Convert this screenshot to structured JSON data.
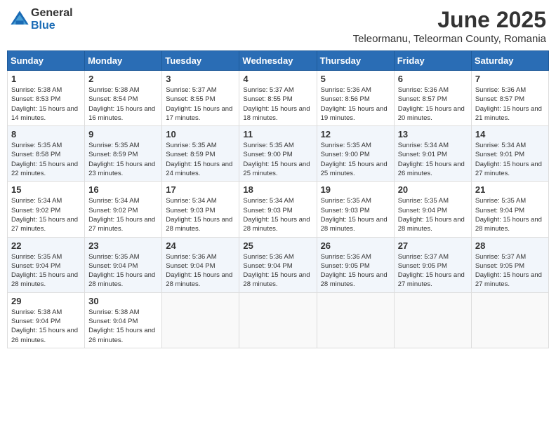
{
  "header": {
    "logo_general": "General",
    "logo_blue": "Blue",
    "month_title": "June 2025",
    "location": "Teleormanu, Teleorman County, Romania"
  },
  "weekdays": [
    "Sunday",
    "Monday",
    "Tuesday",
    "Wednesday",
    "Thursday",
    "Friday",
    "Saturday"
  ],
  "weeks": [
    [
      {
        "day": "1",
        "sunrise": "Sunrise: 5:38 AM",
        "sunset": "Sunset: 8:53 PM",
        "daylight": "Daylight: 15 hours and 14 minutes."
      },
      {
        "day": "2",
        "sunrise": "Sunrise: 5:38 AM",
        "sunset": "Sunset: 8:54 PM",
        "daylight": "Daylight: 15 hours and 16 minutes."
      },
      {
        "day": "3",
        "sunrise": "Sunrise: 5:37 AM",
        "sunset": "Sunset: 8:55 PM",
        "daylight": "Daylight: 15 hours and 17 minutes."
      },
      {
        "day": "4",
        "sunrise": "Sunrise: 5:37 AM",
        "sunset": "Sunset: 8:55 PM",
        "daylight": "Daylight: 15 hours and 18 minutes."
      },
      {
        "day": "5",
        "sunrise": "Sunrise: 5:36 AM",
        "sunset": "Sunset: 8:56 PM",
        "daylight": "Daylight: 15 hours and 19 minutes."
      },
      {
        "day": "6",
        "sunrise": "Sunrise: 5:36 AM",
        "sunset": "Sunset: 8:57 PM",
        "daylight": "Daylight: 15 hours and 20 minutes."
      },
      {
        "day": "7",
        "sunrise": "Sunrise: 5:36 AM",
        "sunset": "Sunset: 8:57 PM",
        "daylight": "Daylight: 15 hours and 21 minutes."
      }
    ],
    [
      {
        "day": "8",
        "sunrise": "Sunrise: 5:35 AM",
        "sunset": "Sunset: 8:58 PM",
        "daylight": "Daylight: 15 hours and 22 minutes."
      },
      {
        "day": "9",
        "sunrise": "Sunrise: 5:35 AM",
        "sunset": "Sunset: 8:59 PM",
        "daylight": "Daylight: 15 hours and 23 minutes."
      },
      {
        "day": "10",
        "sunrise": "Sunrise: 5:35 AM",
        "sunset": "Sunset: 8:59 PM",
        "daylight": "Daylight: 15 hours and 24 minutes."
      },
      {
        "day": "11",
        "sunrise": "Sunrise: 5:35 AM",
        "sunset": "Sunset: 9:00 PM",
        "daylight": "Daylight: 15 hours and 25 minutes."
      },
      {
        "day": "12",
        "sunrise": "Sunrise: 5:35 AM",
        "sunset": "Sunset: 9:00 PM",
        "daylight": "Daylight: 15 hours and 25 minutes."
      },
      {
        "day": "13",
        "sunrise": "Sunrise: 5:34 AM",
        "sunset": "Sunset: 9:01 PM",
        "daylight": "Daylight: 15 hours and 26 minutes."
      },
      {
        "day": "14",
        "sunrise": "Sunrise: 5:34 AM",
        "sunset": "Sunset: 9:01 PM",
        "daylight": "Daylight: 15 hours and 27 minutes."
      }
    ],
    [
      {
        "day": "15",
        "sunrise": "Sunrise: 5:34 AM",
        "sunset": "Sunset: 9:02 PM",
        "daylight": "Daylight: 15 hours and 27 minutes."
      },
      {
        "day": "16",
        "sunrise": "Sunrise: 5:34 AM",
        "sunset": "Sunset: 9:02 PM",
        "daylight": "Daylight: 15 hours and 27 minutes."
      },
      {
        "day": "17",
        "sunrise": "Sunrise: 5:34 AM",
        "sunset": "Sunset: 9:03 PM",
        "daylight": "Daylight: 15 hours and 28 minutes."
      },
      {
        "day": "18",
        "sunrise": "Sunrise: 5:34 AM",
        "sunset": "Sunset: 9:03 PM",
        "daylight": "Daylight: 15 hours and 28 minutes."
      },
      {
        "day": "19",
        "sunrise": "Sunrise: 5:35 AM",
        "sunset": "Sunset: 9:03 PM",
        "daylight": "Daylight: 15 hours and 28 minutes."
      },
      {
        "day": "20",
        "sunrise": "Sunrise: 5:35 AM",
        "sunset": "Sunset: 9:04 PM",
        "daylight": "Daylight: 15 hours and 28 minutes."
      },
      {
        "day": "21",
        "sunrise": "Sunrise: 5:35 AM",
        "sunset": "Sunset: 9:04 PM",
        "daylight": "Daylight: 15 hours and 28 minutes."
      }
    ],
    [
      {
        "day": "22",
        "sunrise": "Sunrise: 5:35 AM",
        "sunset": "Sunset: 9:04 PM",
        "daylight": "Daylight: 15 hours and 28 minutes."
      },
      {
        "day": "23",
        "sunrise": "Sunrise: 5:35 AM",
        "sunset": "Sunset: 9:04 PM",
        "daylight": "Daylight: 15 hours and 28 minutes."
      },
      {
        "day": "24",
        "sunrise": "Sunrise: 5:36 AM",
        "sunset": "Sunset: 9:04 PM",
        "daylight": "Daylight: 15 hours and 28 minutes."
      },
      {
        "day": "25",
        "sunrise": "Sunrise: 5:36 AM",
        "sunset": "Sunset: 9:04 PM",
        "daylight": "Daylight: 15 hours and 28 minutes."
      },
      {
        "day": "26",
        "sunrise": "Sunrise: 5:36 AM",
        "sunset": "Sunset: 9:05 PM",
        "daylight": "Daylight: 15 hours and 28 minutes."
      },
      {
        "day": "27",
        "sunrise": "Sunrise: 5:37 AM",
        "sunset": "Sunset: 9:05 PM",
        "daylight": "Daylight: 15 hours and 27 minutes."
      },
      {
        "day": "28",
        "sunrise": "Sunrise: 5:37 AM",
        "sunset": "Sunset: 9:05 PM",
        "daylight": "Daylight: 15 hours and 27 minutes."
      }
    ],
    [
      {
        "day": "29",
        "sunrise": "Sunrise: 5:38 AM",
        "sunset": "Sunset: 9:04 PM",
        "daylight": "Daylight: 15 hours and 26 minutes."
      },
      {
        "day": "30",
        "sunrise": "Sunrise: 5:38 AM",
        "sunset": "Sunset: 9:04 PM",
        "daylight": "Daylight: 15 hours and 26 minutes."
      },
      null,
      null,
      null,
      null,
      null
    ]
  ]
}
